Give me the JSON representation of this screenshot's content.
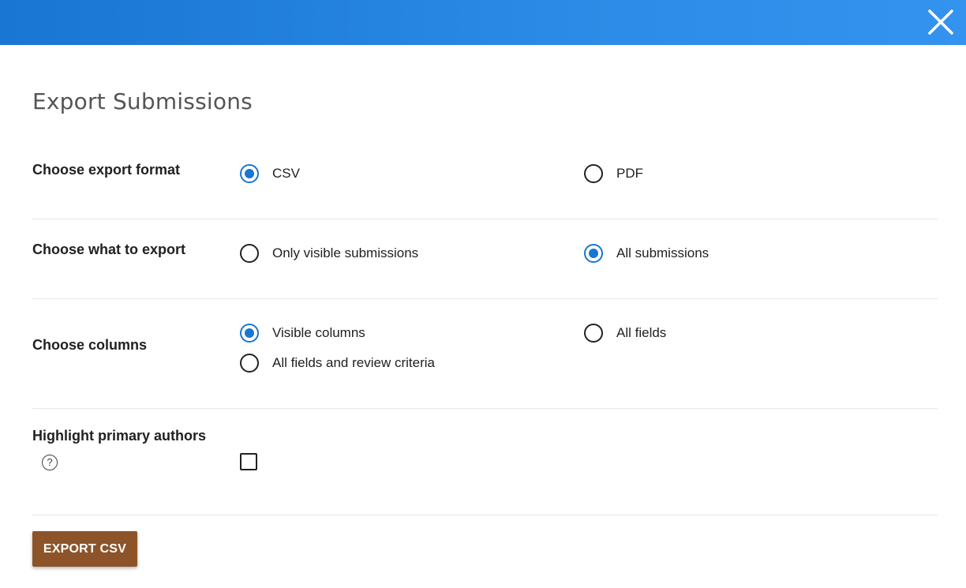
{
  "dialog": {
    "title": "Export Submissions",
    "accent_color": "#1976d2",
    "button_color": "#8d5429"
  },
  "format": {
    "label": "Choose export format",
    "options": [
      {
        "label": "CSV",
        "selected": true
      },
      {
        "label": "PDF",
        "selected": false
      }
    ]
  },
  "scope": {
    "label": "Choose what to export",
    "options": [
      {
        "label": "Only visible submissions",
        "selected": false
      },
      {
        "label": "All submissions",
        "selected": true
      }
    ]
  },
  "columns": {
    "label": "Choose columns",
    "options": [
      {
        "label": "Visible columns",
        "selected": true
      },
      {
        "label": "All fields",
        "selected": false
      },
      {
        "label": "All fields and review criteria",
        "selected": false
      }
    ]
  },
  "highlight": {
    "label": "Highlight primary authors",
    "help_icon_glyph": "?",
    "checked": false
  },
  "actions": {
    "export_label": "EXPORT CSV"
  }
}
